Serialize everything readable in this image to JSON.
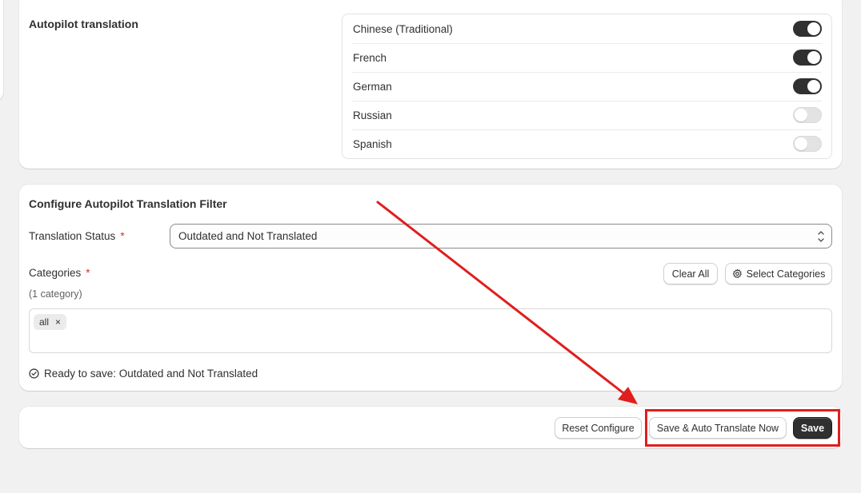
{
  "autopilot": {
    "title": "Autopilot translation",
    "languages": [
      {
        "label": "Chinese (Traditional)",
        "enabled": true
      },
      {
        "label": "French",
        "enabled": true
      },
      {
        "label": "German",
        "enabled": true
      },
      {
        "label": "Russian",
        "enabled": false
      },
      {
        "label": "Spanish",
        "enabled": false
      }
    ]
  },
  "filter": {
    "title": "Configure Autopilot Translation Filter",
    "status_label": "Translation Status",
    "required_mark": "*",
    "status_value": "Outdated and Not Translated",
    "categories_label": "Categories",
    "categories_count": "(1 category)",
    "clear_all_label": "Clear All",
    "select_categories_label": "Select Categories",
    "tags": [
      {
        "label": "all",
        "remove": "×"
      }
    ],
    "ready_text": "Ready to save: Outdated and Not Translated"
  },
  "actions": {
    "reset_label": "Reset Configure",
    "save_translate_label": "Save & Auto Translate Now",
    "save_label": "Save"
  },
  "colors": {
    "background": "#f1f1f1",
    "toggle_on": "#303030",
    "toggle_off": "#e3e3e3",
    "annotation": "#e01e1e",
    "required": "#c0392b"
  },
  "icons": [
    "chevron-up-down-icon",
    "gear-icon",
    "close-icon",
    "check-circle-icon"
  ]
}
